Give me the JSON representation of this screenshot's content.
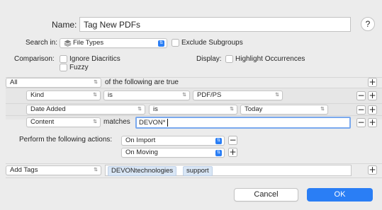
{
  "header": {
    "name_label": "Name:",
    "name_value": "Tag New PDFs",
    "help_icon_text": "?"
  },
  "search": {
    "label": "Search in:",
    "value": "File Types",
    "exclude_label": "Exclude Subgroups"
  },
  "comparison": {
    "label": "Comparison:",
    "ignore_diacritics": "Ignore Diacritics",
    "fuzzy": "Fuzzy"
  },
  "display": {
    "label": "Display:",
    "highlight": "Highlight Occurrences"
  },
  "match": {
    "quantifier": "All",
    "suffix": "of the following are true"
  },
  "criteria": [
    {
      "field": "Kind",
      "operator": "is",
      "value": "PDF/PS"
    },
    {
      "field": "Date Added",
      "operator": "is",
      "value": "Today"
    },
    {
      "field": "Content",
      "operator": "matches",
      "value": "DEVON*"
    }
  ],
  "actions": {
    "label": "Perform the following actions:",
    "triggers": [
      "On Import",
      "On Moving"
    ],
    "action_type": "Add Tags",
    "tags": [
      "DEVONtechnologies",
      "support"
    ]
  },
  "buttons": {
    "plus": "+",
    "minus": "−",
    "cancel": "Cancel",
    "ok": "OK"
  },
  "colors": {
    "accent": "#2a7ef5",
    "focus_ring": "#7aa9ee",
    "tag_fill": "#d9e6f5"
  }
}
